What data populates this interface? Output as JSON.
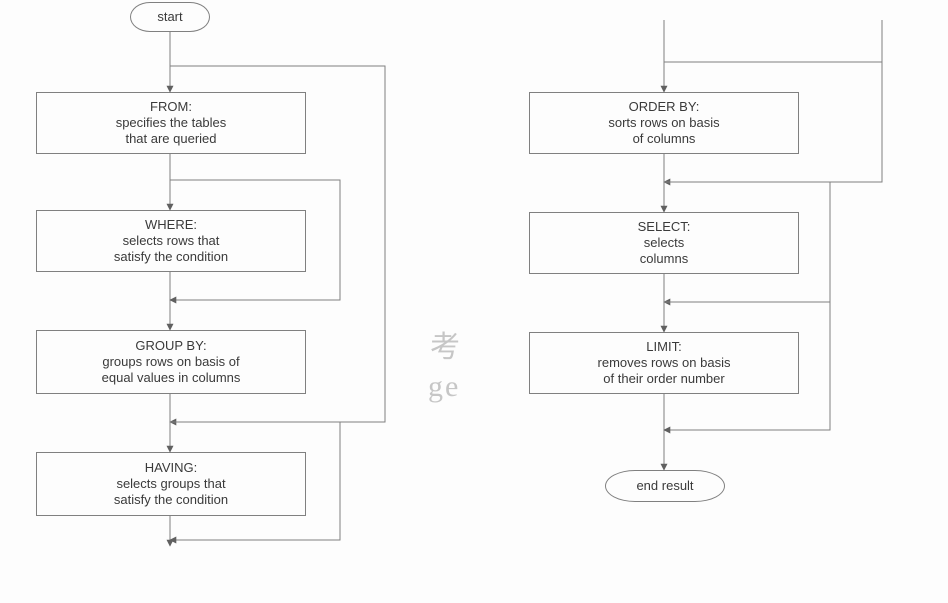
{
  "chart_data": {
    "type": "flowchart",
    "start": "start",
    "end": "end result",
    "steps": [
      {
        "id": "from",
        "title": "FROM:",
        "desc": "specifies the tables\nthat are queried"
      },
      {
        "id": "where",
        "title": "WHERE:",
        "desc": "selects rows that\nsatisfy the condition"
      },
      {
        "id": "groupby",
        "title": "GROUP BY:",
        "desc": "groups rows on basis of\nequal values in columns"
      },
      {
        "id": "having",
        "title": "HAVING:",
        "desc": "selects groups that\nsatisfy the condition"
      },
      {
        "id": "orderby",
        "title": "ORDER BY:",
        "desc": "sorts rows on basis\nof columns"
      },
      {
        "id": "select",
        "title": "SELECT:",
        "desc": "selects\ncolumns"
      },
      {
        "id": "limit",
        "title": "LIMIT:",
        "desc": "removes rows on basis\nof their order number"
      }
    ],
    "bypasses": [
      "from→groupby (skip WHERE)",
      "where→having (skip GROUP BY)",
      "groupby→orderby (skip HAVING)",
      "orderby→limit (skip SELECT)",
      "start→orderby (skip FROM/WHERE/GROUP BY/HAVING)"
    ]
  },
  "nodes": {
    "start": {
      "label": "start"
    },
    "from": {
      "title": "FROM:",
      "line1": "specifies the tables",
      "line2": "that are queried"
    },
    "where": {
      "title": "WHERE:",
      "line1": "selects rows that",
      "line2": "satisfy the condition"
    },
    "groupby": {
      "title": "GROUP BY:",
      "line1": "groups rows on basis of",
      "line2": "equal values in columns"
    },
    "having": {
      "title": "HAVING:",
      "line1": "selects groups that",
      "line2": "satisfy the condition"
    },
    "orderby": {
      "title": "ORDER BY:",
      "line1": "sorts rows on basis",
      "line2": "of columns"
    },
    "select": {
      "title": "SELECT:",
      "line1": "selects",
      "line2": "columns"
    },
    "limit": {
      "title": "LIMIT:",
      "line1": "removes rows on basis",
      "line2": "of their order number"
    },
    "end": {
      "label": "end result"
    }
  },
  "watermark": {
    "char1": "考",
    "char2": "ge"
  }
}
